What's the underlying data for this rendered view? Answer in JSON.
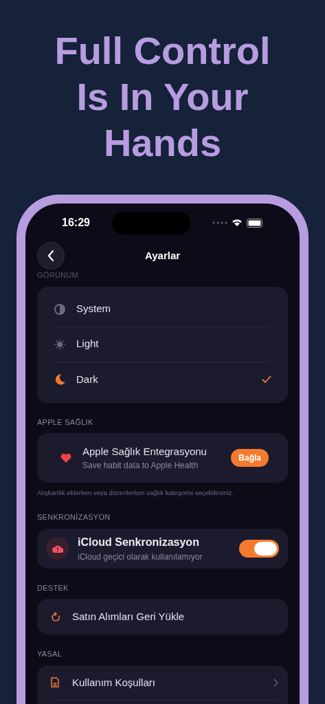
{
  "headline": "Full Control Is In Your Hands",
  "status_bar": {
    "time": "16:29"
  },
  "nav": {
    "title": "Ayarlar"
  },
  "appearance": {
    "header": "GÖRÜNUM",
    "options": [
      {
        "kind": "system",
        "label": "System",
        "selected": false
      },
      {
        "kind": "light",
        "label": "Light",
        "selected": false
      },
      {
        "kind": "dark",
        "label": "Dark",
        "selected": true
      }
    ]
  },
  "health": {
    "header": "APPLE SAĞLIK",
    "title": "Apple Sağlık Entegrasyonu",
    "subtitle": "Save habit data to Apple Health",
    "button": "Bağla",
    "footnote": "Alışkanlık eklerken veya düzenlerken sağlık kategorisi seçebilirsiniz."
  },
  "sync": {
    "header": "SENKRONİZASYON",
    "title": "iCloud Senkronizasyon",
    "subtitle": "iCloud geçici olarak kullanılamıyor",
    "on": true
  },
  "support": {
    "header": "DESTEK",
    "item": "Satın Alımları Geri Yükle"
  },
  "legal": {
    "header": "YASAL",
    "items": [
      "Kullanım Koşulları"
    ]
  }
}
